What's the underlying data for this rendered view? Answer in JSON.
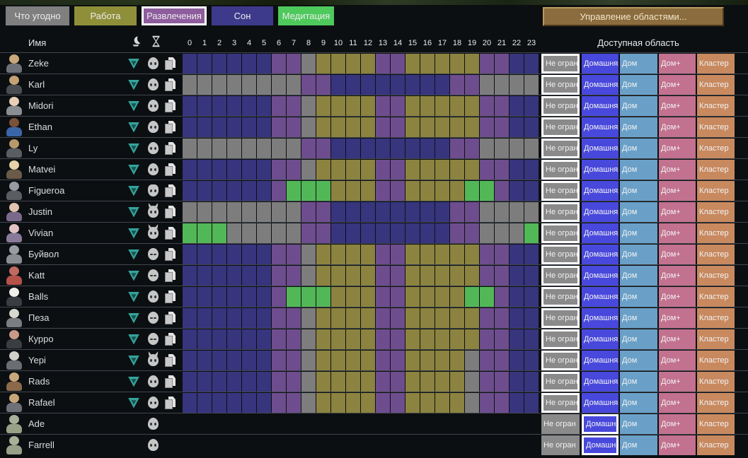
{
  "toolbar": {
    "buttons": [
      {
        "label": "Что угодно",
        "color": "#7f7f7f",
        "selected": false
      },
      {
        "label": "Работа",
        "color": "#8f8f3a",
        "selected": false
      },
      {
        "label": "Развлечения",
        "color": "#8e5d9e",
        "selected": true
      },
      {
        "label": "Сон",
        "color": "#3d3a8c",
        "selected": false
      },
      {
        "label": "Медитация",
        "color": "#4ec95c",
        "selected": false
      }
    ],
    "manage_areas_label": "Управление областями..."
  },
  "header": {
    "name_label": "Имя",
    "allowed_area_label": "Доступная область",
    "icons": [
      "moon-icon",
      "hourglass-icon"
    ],
    "hours": [
      "0",
      "1",
      "2",
      "3",
      "4",
      "5",
      "6",
      "7",
      "8",
      "9",
      "10",
      "11",
      "12",
      "13",
      "14",
      "15",
      "16",
      "17",
      "18",
      "19",
      "20",
      "21",
      "22",
      "23"
    ]
  },
  "palette": {
    "S": "#37357e",
    "A": "#7d7d7d",
    "J": "#6e4d8e",
    "W": "#8b833f",
    "M": "#52b857"
  },
  "palette_legend": {
    "S": "sleep",
    "A": "anything",
    "J": "joy",
    "W": "work",
    "M": "meditation"
  },
  "row_icons": [
    "ideology-icon",
    "xenotype-icon",
    "copy-schedule-icon"
  ],
  "areas": [
    {
      "label": "Не огран",
      "color": "#8a8a8a",
      "slug": "unrestricted"
    },
    {
      "label": "Домашняя",
      "color": "#4848dc",
      "slug": "home"
    },
    {
      "label": "Дом",
      "color": "#6aa0c8",
      "slug": "dom"
    },
    {
      "label": "Дом+",
      "color": "#c2718e",
      "slug": "dom-plus"
    },
    {
      "label": "Кластер",
      "color": "#c8895f",
      "slug": "cluster"
    }
  ],
  "colonists": [
    {
      "name": "Zeke",
      "xenotype": "face",
      "head": "#c8a87a",
      "body": "#6e7178",
      "schedule": "SSSSSSJJAWWWWJJWWWWWJJSS",
      "selected_area": 0,
      "tools": true
    },
    {
      "name": "Karl",
      "xenotype": "face",
      "head": "#c4a274",
      "body": "#4a4d52",
      "schedule": "AAAAAAAAJJSSSSSSSSJJAAAA",
      "selected_area": 0,
      "tools": true
    },
    {
      "name": "Midori",
      "xenotype": "face",
      "head": "#e8d0b8",
      "body": "#8a8d92",
      "schedule": "SSSSSSJJAWWWWJJWWWWWJJSS",
      "selected_area": 0,
      "tools": true
    },
    {
      "name": "Ethan",
      "xenotype": "face",
      "head": "#7a5238",
      "body": "#3a66a8",
      "schedule": "SSSSSSJJAWWWWJJWWWWWJJSS",
      "selected_area": 0,
      "tools": true
    },
    {
      "name": "Ly",
      "xenotype": "face",
      "head": "#b89a6a",
      "body": "#5a5d62",
      "schedule": "AAAAAAAAJJSSSSSSSSJJAAAA",
      "selected_area": 0,
      "tools": true
    },
    {
      "name": "Matvei",
      "xenotype": "face",
      "head": "#e8d2a8",
      "body": "#6a5a48",
      "schedule": "SSSSSSJJAWWWWJJWWWWWJJSS",
      "selected_area": 0,
      "tools": true
    },
    {
      "name": "Figueroa",
      "xenotype": "waved",
      "head": "#9a9aa2",
      "body": "#5a5d62",
      "schedule": "SSSSSSJMMMWWWJJWWWWMMJSS",
      "selected_area": 0,
      "tools": true
    },
    {
      "name": "Justin",
      "xenotype": "horned",
      "head": "#e0c2b0",
      "body": "#7a6a8a",
      "schedule": "AAAAAAAAJJSSSSSSSSJJAAAA",
      "selected_area": 0,
      "tools": true
    },
    {
      "name": "Vivian",
      "xenotype": "horned",
      "head": "#e2c4c4",
      "body": "#8a7a9a",
      "schedule": "MMMAAAAAJJSSSSSSSSJJAAAM",
      "selected_area": 0,
      "tools": true
    },
    {
      "name": "Буйвол",
      "xenotype": "masked",
      "head": "#9a9da2",
      "body": "#8a8d92",
      "schedule": "SSSSSSJJAWWWWJJWWWWWJJSS",
      "selected_area": 0,
      "tools": true
    },
    {
      "name": "Katt",
      "xenotype": "masked",
      "head": "#c06a62",
      "body": "#b5524a",
      "schedule": "SSSSSSJJAWWWWJJWWWWWJJSS",
      "selected_area": 0,
      "tools": true
    },
    {
      "name": "Balls",
      "xenotype": "face",
      "head": "#f0f0e8",
      "body": "#3a3d42",
      "schedule": "SSSSSSJMMMWWWJJWWWWMMJSS",
      "selected_area": 0,
      "tools": true
    },
    {
      "name": "Пеза",
      "xenotype": "masked",
      "head": "#d8d8d0",
      "body": "#7a7d82",
      "schedule": "SSSSSSJJAWWWWJJWWWWWJJSS",
      "selected_area": 0,
      "tools": true
    },
    {
      "name": "Курро",
      "xenotype": "masked",
      "head": "#c89a8a",
      "body": "#3a3d42",
      "schedule": "SSSSSSJJAWWWWJJWWWWWJJSS",
      "selected_area": 0,
      "tools": true
    },
    {
      "name": "Yepi",
      "xenotype": "eared",
      "head": "#d0d0c8",
      "body": "#6a6d72",
      "schedule": "SSSSSSJJAWWWWJJWWWWAJJSS",
      "selected_area": 0,
      "tools": true
    },
    {
      "name": "Rads",
      "xenotype": "face",
      "head": "#c8a87a",
      "body": "#8a6a4a",
      "schedule": "SSSSSSJJAWWWWJJWWWWAJJSS",
      "selected_area": 0,
      "tools": true
    },
    {
      "name": "Rafael",
      "xenotype": "face",
      "head": "#c8a87a",
      "body": "#6e7178",
      "schedule": "SSSSSSJJAWWWWJJWWWWAJJSS",
      "selected_area": 0,
      "tools": true
    },
    {
      "name": "Ade",
      "xenotype": "face",
      "head": "#a8b098",
      "body": "#98a088",
      "schedule": "",
      "selected_area": 1,
      "tools": false
    },
    {
      "name": "Farrell",
      "xenotype": "face",
      "head": "#a8b098",
      "body": "#98a088",
      "schedule": "",
      "selected_area": 1,
      "tools": false
    }
  ]
}
